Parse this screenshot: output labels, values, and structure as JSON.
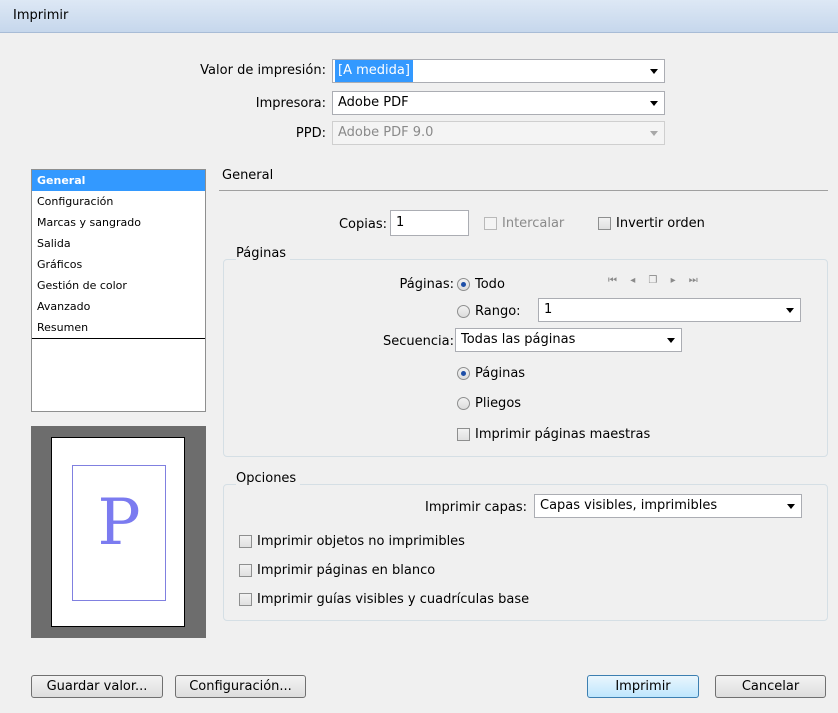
{
  "window": {
    "title": "Imprimir"
  },
  "top": {
    "preset_label": "Valor de impresión:",
    "preset_value": "[A medida]",
    "printer_label": "Impresora:",
    "printer_value": "Adobe PDF",
    "ppd_label": "PPD:",
    "ppd_value": "Adobe PDF 9.0"
  },
  "sidebar": {
    "items": [
      {
        "label": "General"
      },
      {
        "label": "Configuración"
      },
      {
        "label": "Marcas y sangrado"
      },
      {
        "label": "Salida"
      },
      {
        "label": "Gráficos"
      },
      {
        "label": "Gestión de color"
      },
      {
        "label": "Avanzado"
      },
      {
        "label": "Resumen"
      }
    ]
  },
  "preview": {
    "letter": "P"
  },
  "general": {
    "title": "General",
    "copies_label": "Copias:",
    "copies_value": "1",
    "collate_label": "Intercalar",
    "reverse_label": "Invertir orden"
  },
  "pages": {
    "title": "Páginas",
    "pages_label": "Páginas:",
    "all_label": "Todo",
    "range_label": "Rango:",
    "range_value": "1",
    "sequence_label": "Secuencia:",
    "sequence_value": "Todas las páginas",
    "pages_option": "Páginas",
    "spreads_option": "Pliegos",
    "master_label": "Imprimir páginas maestras",
    "nav_icons": [
      "first-page-icon",
      "prev-page-icon",
      "page-set-icon",
      "next-page-icon",
      "last-page-icon"
    ]
  },
  "options": {
    "title": "Opciones",
    "layers_label": "Imprimir capas:",
    "layers_value": "Capas visibles, imprimibles",
    "nonprinting_label": "Imprimir objetos no imprimibles",
    "blank_label": "Imprimir páginas en blanco",
    "guides_label": "Imprimir guías visibles y cuadrículas base"
  },
  "buttons": {
    "save_preset": "Guardar valor...",
    "setup": "Configuración...",
    "print": "Imprimir",
    "cancel": "Cancelar"
  },
  "colors": {
    "accent": "#3399ff",
    "preview_letter": "#7b7bf0"
  }
}
